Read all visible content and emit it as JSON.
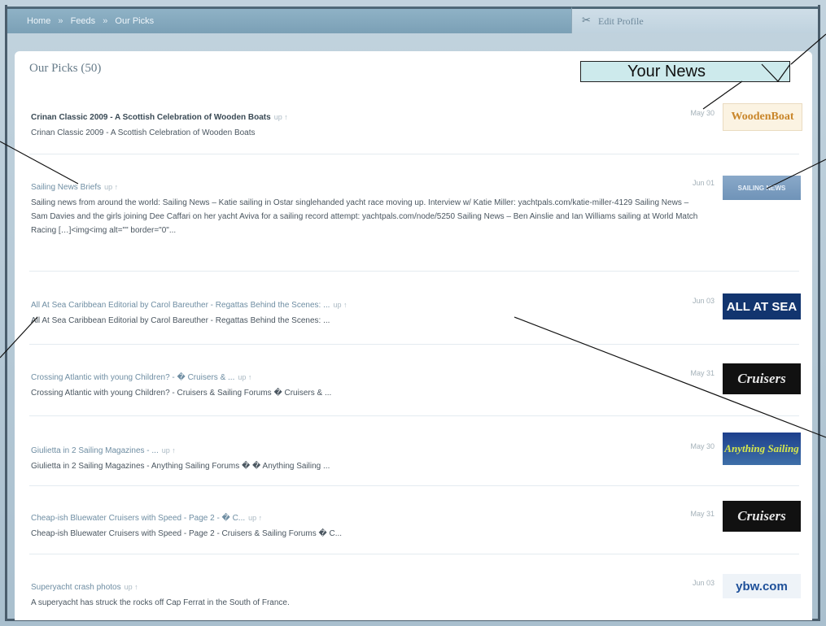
{
  "breadcrumb": {
    "home": "Home",
    "feeds": "Feeds",
    "current": "Our Picks",
    "separator": "»"
  },
  "edit_profile": {
    "icon": "wrench-tools-icon",
    "label": "Edit Profile"
  },
  "page_title": "Our Picks (50)",
  "callout": {
    "label": "Your News"
  },
  "vote_text": "up ↑",
  "items": [
    {
      "title": "Crinan Classic 2009 - A Scottish Celebration of Wooden Boats",
      "description": "Crinan Classic 2009 - A Scottish Celebration of Wooden Boats",
      "date": "May 30",
      "thumb": "WoodenBoat"
    },
    {
      "title": "Sailing News Briefs",
      "description": "Sailing news from around the world: Sailing News – Katie sailing in Ostar singlehanded yacht race moving up. Interview w/ Katie Miller: yachtpals.com/katie-miller-4129 Sailing News – Sam Davies and the girls joining Dee Caffari on her yacht Aviva for a sailing record attempt: yachtpals.com/node/5250 Sailing News – Ben Ainslie and Ian Williams sailing at World Match Racing […]<img<img alt=\"\" border=\"0\"...",
      "date": "Jun 01",
      "thumb": "SAILING NEWS"
    },
    {
      "title": "All At Sea Caribbean Editorial by Carol Bareuther - Regattas Behind the Scenes: ...",
      "description": "All At Sea Caribbean Editorial by Carol Bareuther - Regattas Behind the Scenes: ...",
      "date": "Jun 03",
      "thumb": "ALL AT SEA"
    },
    {
      "title": "Crossing Atlantic with young Children? - � Cruisers & ...",
      "description": "Crossing Atlantic with young Children? - Cruisers & Sailing Forums � Cruisers & ...",
      "date": "May 31",
      "thumb": "Cruisers"
    },
    {
      "title": "Giulietta in 2 Sailing Magazines - ...",
      "description": "Giulietta in 2 Sailing Magazines - Anything Sailing Forums � � Anything Sailing ...",
      "date": "May 30",
      "thumb": "Anything Sailing"
    },
    {
      "title": "Cheap-ish Bluewater Cruisers with Speed - Page 2 - � C...",
      "description": "Cheap-ish Bluewater Cruisers with Speed - Page 2 - Cruisers & Sailing Forums � C...",
      "date": "May 31",
      "thumb": "Cruisers"
    },
    {
      "title": "Superyacht crash photos",
      "description": "A superyacht has struck the rocks off Cap Ferrat in the South of France.",
      "date": "Jun 03",
      "thumb": "ybw.com"
    }
  ]
}
